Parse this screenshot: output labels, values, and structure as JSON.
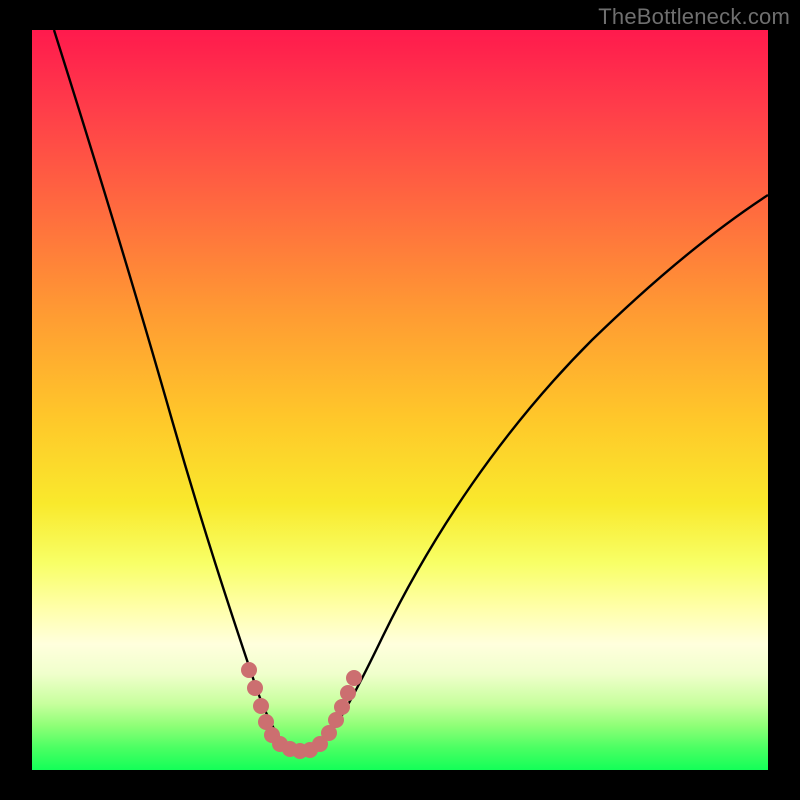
{
  "watermark": "TheBottleneck.com",
  "colors": {
    "frame": "#000000",
    "curve_stroke": "#000000",
    "highlight_stroke": "#cc6f70",
    "gradient_top": "#ff1a4d",
    "gradient_bottom": "#13ff58"
  },
  "chart_data": {
    "type": "line",
    "title": "",
    "xlabel": "",
    "ylabel": "",
    "xlim": [
      0,
      100
    ],
    "ylim": [
      0,
      100
    ],
    "grid": false,
    "legend": false,
    "series": [
      {
        "name": "bottleneck-curve",
        "x": [
          3,
          6,
          10,
          14,
          18,
          22,
          26,
          28,
          30,
          32,
          33,
          34,
          35,
          36,
          37,
          38,
          40,
          44,
          50,
          58,
          66,
          76,
          86,
          94,
          100
        ],
        "y": [
          100,
          90,
          78,
          66,
          54,
          42,
          30,
          24,
          18,
          12,
          9,
          7,
          5,
          4,
          4,
          4.5,
          6,
          11,
          20,
          31,
          41,
          51,
          59,
          64,
          67
        ]
      }
    ],
    "highlight": {
      "note": "pink dotted segment near minimum",
      "x": [
        28,
        30,
        31,
        32,
        33,
        34,
        35,
        36,
        37,
        38,
        40,
        42,
        44
      ],
      "y": [
        17,
        12,
        9,
        7,
        5,
        4,
        4,
        4,
        4.5,
        5,
        8,
        12,
        16
      ]
    }
  }
}
